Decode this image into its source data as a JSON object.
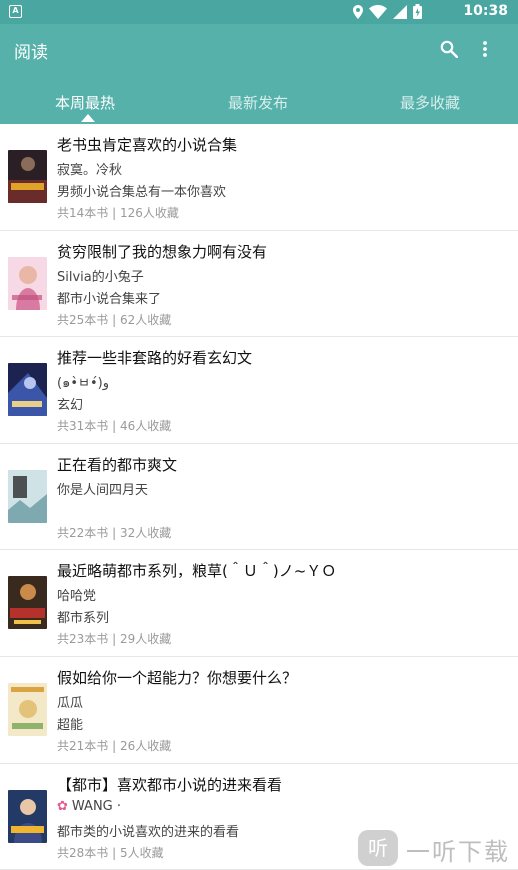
{
  "status_bar": {
    "app_badge": "A",
    "time": "10:38"
  },
  "app_bar": {
    "title": "阅读"
  },
  "tabs": [
    {
      "label": "本周最热",
      "active": true
    },
    {
      "label": "最新发布",
      "active": false
    },
    {
      "label": "最多收藏",
      "active": false
    }
  ],
  "colors": {
    "accent": "#56b1ab",
    "statusbar": "#4aa6a0",
    "meta": "#9a9a9a"
  },
  "items": [
    {
      "title": "老书虫肯定喜欢的小说合集",
      "author": "寂寞。冷秋",
      "desc": "男频小说合集总有一本你喜欢",
      "meta": "共14本书 |  126人收藏"
    },
    {
      "title": "贫穷限制了我的想象力啊有没有",
      "author": "Silvia的小兔子",
      "desc": "都市小说合集来了",
      "meta": "共25本书 |  62人收藏"
    },
    {
      "title": "推荐一些非套路的好看玄幻文",
      "author": "(๑•̀ㅂ•́)و",
      "desc": "玄幻",
      "meta": "共31本书 |  46人收藏"
    },
    {
      "title": "正在看的都市爽文",
      "author": "你是人间四月天",
      "desc": "",
      "meta": "共22本书 |  32人收藏"
    },
    {
      "title": "最近略萌都市系列，粮草(＾Ｕ＾)ノ~ＹＯ",
      "author": "哈哈党",
      "desc": "都市系列",
      "meta": "共23本书 |  29人收藏"
    },
    {
      "title": "假如给你一个超能力？你想要什么？",
      "author": "瓜瓜",
      "desc": "超能",
      "meta": "共21本书 |  26人收藏"
    },
    {
      "title": "【都市】喜欢都市小说的进来看看",
      "author": "WANG ·",
      "desc": "都市类的小说喜欢的进来的看看",
      "meta": "共28本书 |  5人收藏"
    }
  ],
  "watermark": {
    "logo": "听",
    "text": "一听下载"
  }
}
